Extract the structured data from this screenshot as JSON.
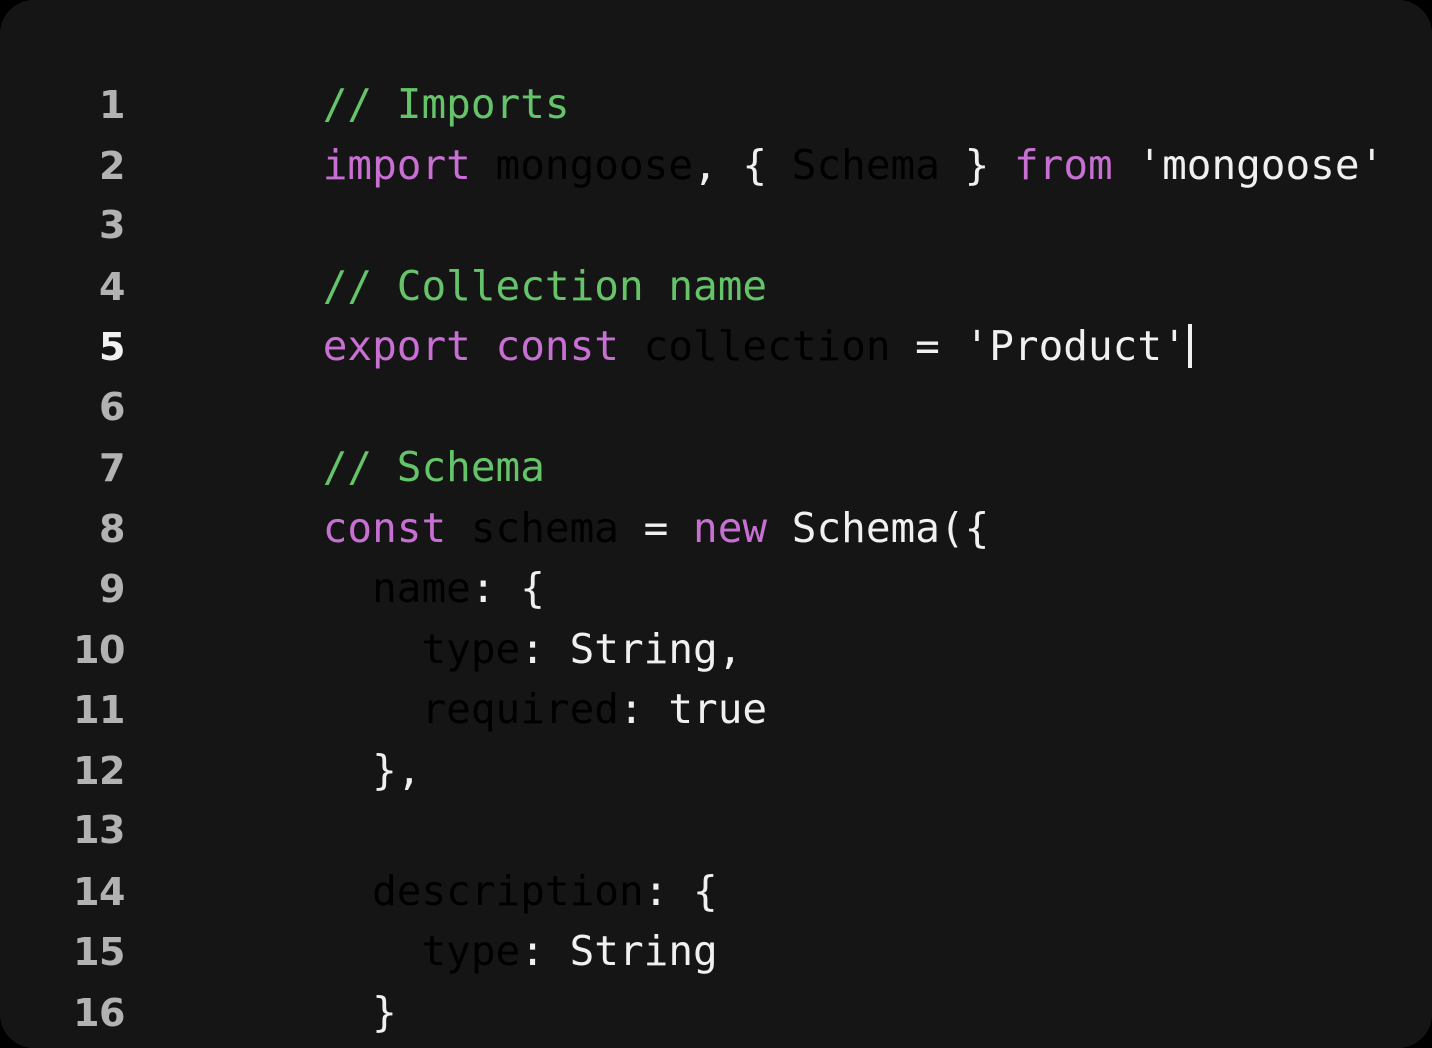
{
  "editor": {
    "language": "javascript",
    "theme_background": "#151515",
    "page_background": "#000000",
    "active_line": 5,
    "cursor_line": 5,
    "cursor_column": 31,
    "colors": {
      "comment": "#65c46a",
      "keyword": "#c86fd4",
      "identifier": "#7cc5f5",
      "property": "#7cc5f5",
      "plain": "#f0f0f0",
      "string": "#f0f0f0",
      "gutter": "#b2b2b2",
      "gutter_active": "#f2f2f2",
      "caret": "#f0f0f0"
    },
    "lines": [
      {
        "number": "1",
        "tokens": [
          {
            "t": "    ",
            "c": "plain"
          },
          {
            "t": "// Imports",
            "c": "comment"
          }
        ]
      },
      {
        "number": "2",
        "tokens": [
          {
            "t": "    ",
            "c": "plain"
          },
          {
            "t": "import",
            "c": "keyword"
          },
          {
            "t": " ",
            "c": "plain"
          },
          {
            "t": "mongoose",
            "c": "identifier"
          },
          {
            "t": ", { ",
            "c": "punct"
          },
          {
            "t": "Schema",
            "c": "identifier"
          },
          {
            "t": " } ",
            "c": "punct"
          },
          {
            "t": "from",
            "c": "keyword"
          },
          {
            "t": " ",
            "c": "plain"
          },
          {
            "t": "'mongoose'",
            "c": "string"
          }
        ]
      },
      {
        "number": "3",
        "tokens": []
      },
      {
        "number": "4",
        "tokens": [
          {
            "t": "    ",
            "c": "plain"
          },
          {
            "t": "// Collection name",
            "c": "comment"
          }
        ]
      },
      {
        "number": "5",
        "tokens": [
          {
            "t": "    ",
            "c": "plain"
          },
          {
            "t": "export const",
            "c": "keyword"
          },
          {
            "t": " ",
            "c": "plain"
          },
          {
            "t": "collection",
            "c": "identifier"
          },
          {
            "t": " = ",
            "c": "op"
          },
          {
            "t": "'Product'",
            "c": "string"
          },
          {
            "t": "",
            "c": "caret"
          }
        ]
      },
      {
        "number": "6",
        "tokens": []
      },
      {
        "number": "7",
        "tokens": [
          {
            "t": "    ",
            "c": "plain"
          },
          {
            "t": "// Schema",
            "c": "comment"
          }
        ]
      },
      {
        "number": "8",
        "tokens": [
          {
            "t": "    ",
            "c": "plain"
          },
          {
            "t": "const",
            "c": "keyword"
          },
          {
            "t": " ",
            "c": "plain"
          },
          {
            "t": "schema",
            "c": "identifier"
          },
          {
            "t": " = ",
            "c": "op"
          },
          {
            "t": "new",
            "c": "keyword"
          },
          {
            "t": " ",
            "c": "plain"
          },
          {
            "t": "Schema({",
            "c": "plain"
          }
        ]
      },
      {
        "number": "9",
        "tokens": [
          {
            "t": "      ",
            "c": "plain"
          },
          {
            "t": "name",
            "c": "property"
          },
          {
            "t": ": {",
            "c": "punct"
          }
        ]
      },
      {
        "number": "10",
        "tokens": [
          {
            "t": "        ",
            "c": "plain"
          },
          {
            "t": "type",
            "c": "property"
          },
          {
            "t": ": ",
            "c": "punct"
          },
          {
            "t": "String,",
            "c": "plain"
          }
        ]
      },
      {
        "number": "11",
        "tokens": [
          {
            "t": "        ",
            "c": "plain"
          },
          {
            "t": "required",
            "c": "property"
          },
          {
            "t": ": ",
            "c": "punct"
          },
          {
            "t": "true",
            "c": "plain"
          }
        ]
      },
      {
        "number": "12",
        "tokens": [
          {
            "t": "      ",
            "c": "plain"
          },
          {
            "t": "},",
            "c": "punct"
          }
        ]
      },
      {
        "number": "13",
        "tokens": []
      },
      {
        "number": "14",
        "tokens": [
          {
            "t": "      ",
            "c": "plain"
          },
          {
            "t": "description",
            "c": "property"
          },
          {
            "t": ": {",
            "c": "punct"
          }
        ]
      },
      {
        "number": "15",
        "tokens": [
          {
            "t": "        ",
            "c": "plain"
          },
          {
            "t": "type",
            "c": "property"
          },
          {
            "t": ": ",
            "c": "punct"
          },
          {
            "t": "String",
            "c": "plain"
          }
        ]
      },
      {
        "number": "16",
        "tokens": [
          {
            "t": "      ",
            "c": "plain"
          },
          {
            "t": "}",
            "c": "punct"
          }
        ]
      }
    ]
  }
}
